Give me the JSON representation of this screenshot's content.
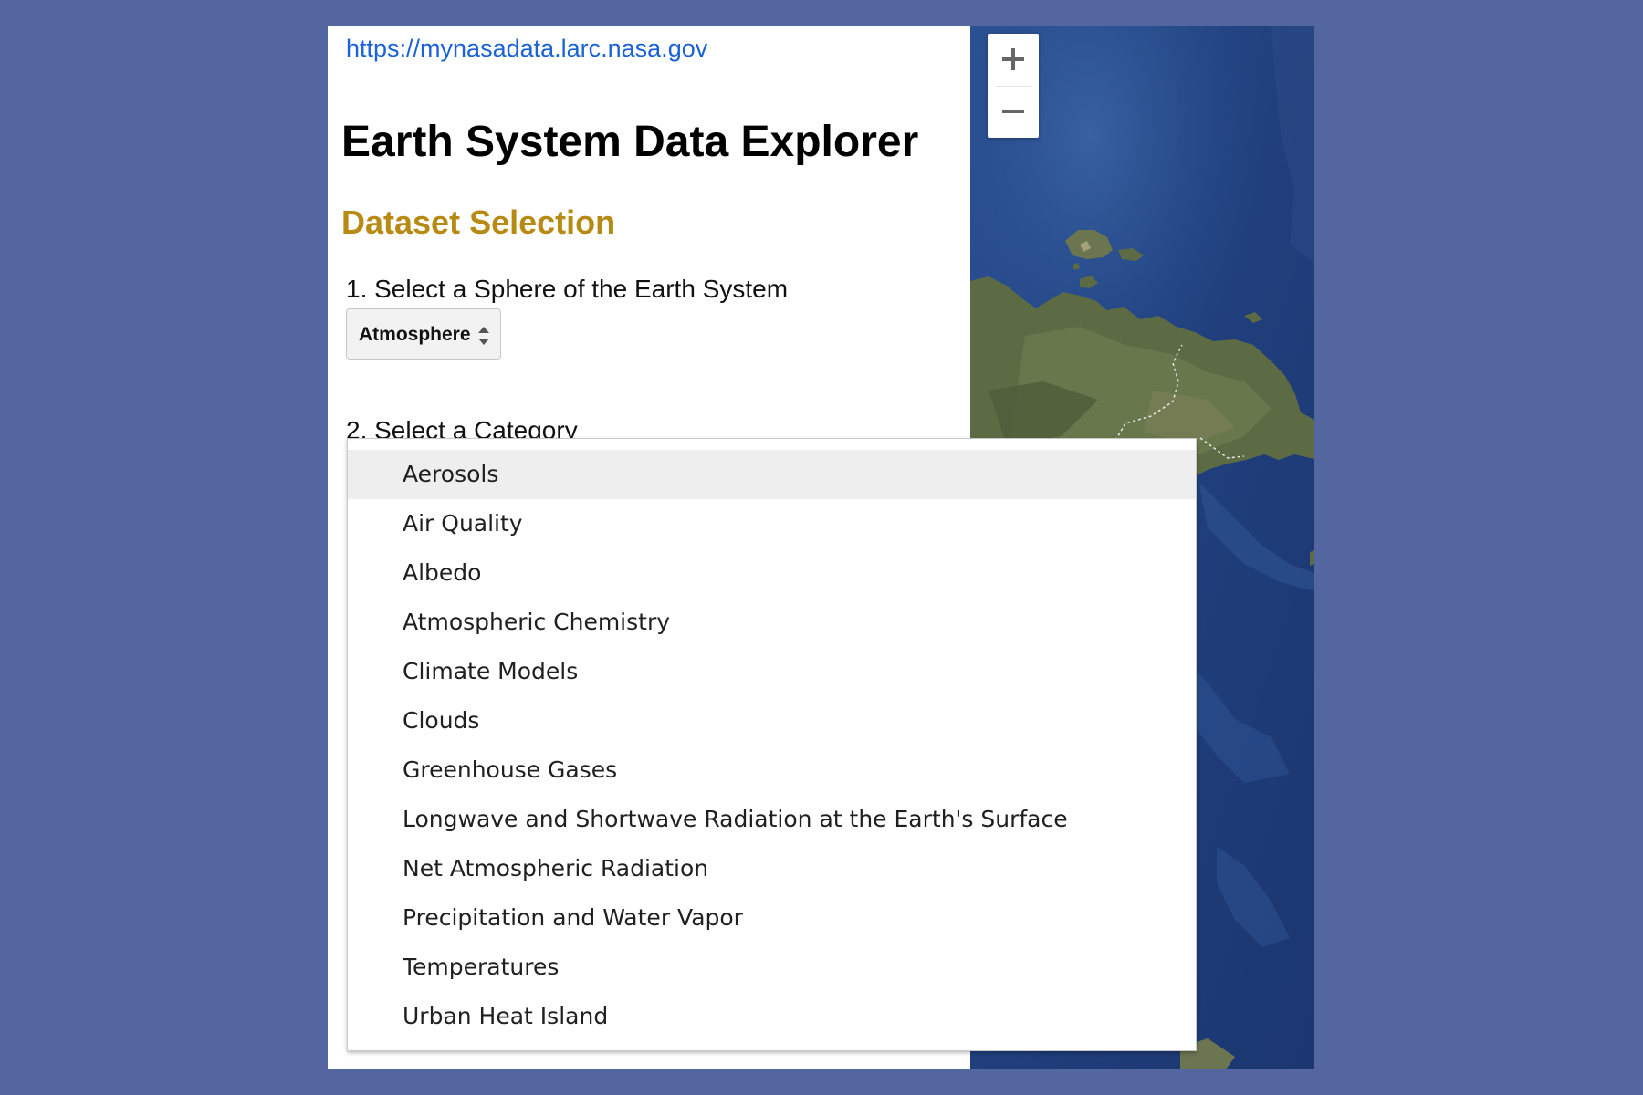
{
  "header": {
    "url": "https://mynasadata.larc.nasa.gov",
    "title": "Earth System Data Explorer"
  },
  "dataset_selection": {
    "heading": "Dataset Selection",
    "heading_color": "#b78a14",
    "step1_label": "1. Select a Sphere of the Earth System",
    "sphere_select_value": "Atmosphere",
    "step2_label": "2. Select a Category"
  },
  "category_dropdown": {
    "highlighted_index": 0,
    "options": [
      "Aerosols",
      "Air Quality",
      "Albedo",
      "Atmospheric Chemistry",
      "Climate Models",
      "Clouds",
      "Greenhouse Gases",
      "Longwave and Shortwave Radiation at the Earth's Surface",
      "Net Atmospheric Radiation",
      "Precipitation and Water Vapor",
      "Temperatures",
      "Urban Heat Island"
    ]
  },
  "map": {
    "zoom_in_icon": "plus-icon",
    "zoom_out_icon": "minus-icon"
  },
  "colors": {
    "page_background": "#5466a0",
    "link": "#1a62d6",
    "highlight": "#eeeeee"
  }
}
